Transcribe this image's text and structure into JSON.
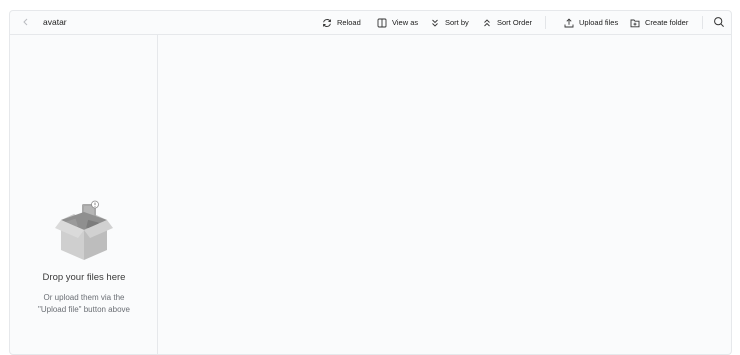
{
  "header": {
    "folder_name": "avatar",
    "reload_label": "Reload",
    "view_as_label": "View as",
    "sort_by_label": "Sort by",
    "sort_order_label": "Sort Order",
    "upload_label": "Upload files",
    "create_folder_label": "Create folder"
  },
  "empty_state": {
    "title": "Drop your files here",
    "subtitle": "Or upload them via the \"Upload file\" button above"
  },
  "icons": {
    "back": "chevron-left-icon",
    "reload": "reload-icon",
    "view_as": "columns-icon",
    "sort_by": "chevrons-down-icon",
    "sort_order": "chevrons-up-icon",
    "upload": "upload-icon",
    "create_folder": "folder-plus-icon",
    "search": "search-icon"
  }
}
